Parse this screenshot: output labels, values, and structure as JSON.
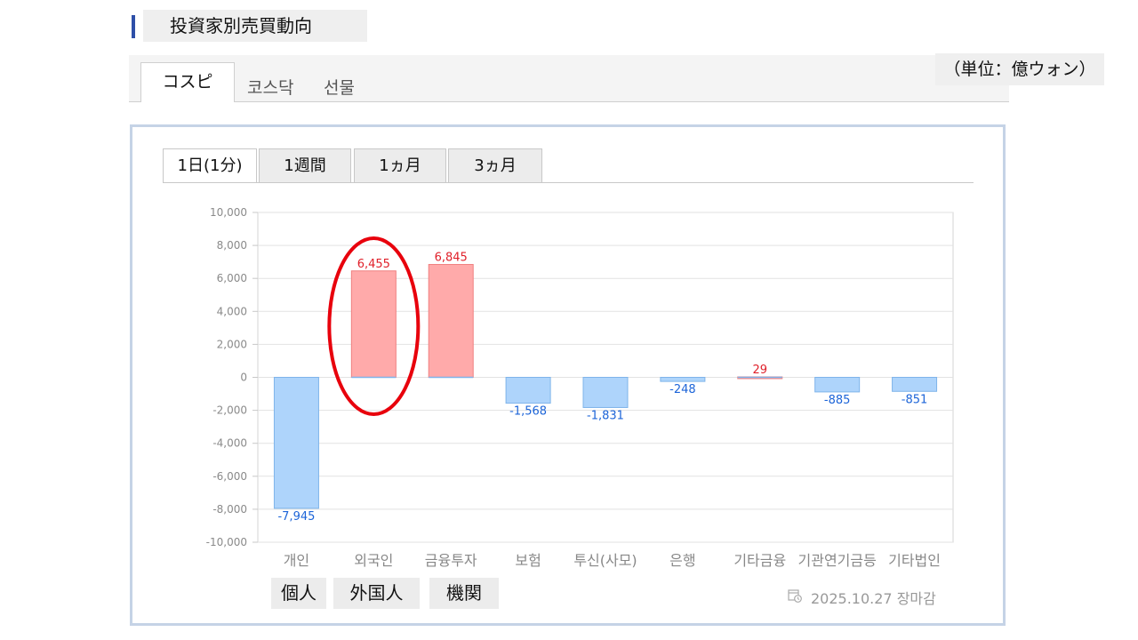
{
  "header": {
    "title": "投資家別売買動向"
  },
  "market_tabs": [
    {
      "label": "コスピ",
      "active": true
    },
    {
      "label": "코스닥",
      "active": false
    },
    {
      "label": "선물",
      "active": false
    }
  ],
  "unit_label": "（単位：億ウォン）",
  "period_tabs": [
    {
      "label": "1日(1分)",
      "active": true
    },
    {
      "label": "1週間",
      "active": false
    },
    {
      "label": "1ヵ月",
      "active": false
    },
    {
      "label": "3ヵ月",
      "active": false
    }
  ],
  "chart_data": {
    "type": "bar",
    "categories": [
      "개인",
      "외국인",
      "금융투자",
      "보험",
      "투신(사모)",
      "은행",
      "기타금융",
      "기관연기금등",
      "기타법인"
    ],
    "values": [
      -7945,
      6455,
      6845,
      -1568,
      -1831,
      -248,
      29,
      -885,
      -851
    ],
    "value_labels": [
      "-7,945",
      "6,455",
      "6,845",
      "-1,568",
      "-1,831",
      "-248",
      "29",
      "-885",
      "-851"
    ],
    "ylim": [
      -10000,
      10000
    ],
    "yticks": [
      10000,
      8000,
      6000,
      4000,
      2000,
      0,
      -2000,
      -4000,
      -6000,
      -8000,
      -10000
    ],
    "ytick_labels": [
      "10,000",
      "8,000",
      "6,000",
      "4,000",
      "2,000",
      "0",
      "-2,000",
      "-4,000",
      "-6,000",
      "-8,000",
      "-10,000"
    ],
    "grid": true,
    "colors": {
      "positive_fill": "#ffaaaa",
      "positive_stroke": "#f08080",
      "positive_label": "#e0202a",
      "negative_fill": "#aed4fb",
      "negative_stroke": "#7fb4ea",
      "negative_label": "#1c64d8",
      "highlight_ellipse": "#e8000c"
    },
    "highlight_category": "외국인"
  },
  "translations": [
    {
      "text": "個人"
    },
    {
      "text": "外国人"
    },
    {
      "text": "機関"
    }
  ],
  "footer": {
    "date": "2025.10.27 장마감",
    "icon": "calendar-clock-icon"
  }
}
